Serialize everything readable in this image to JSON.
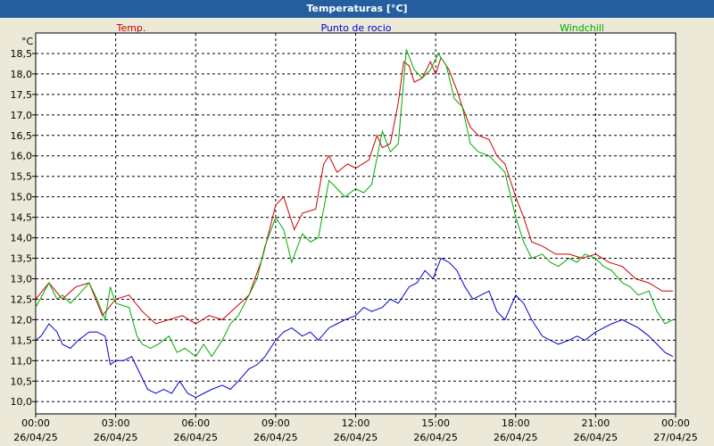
{
  "window": {
    "title": "Temperaturas [°C]"
  },
  "colors": {
    "temp": "#cc0000",
    "dew": "#0000cc",
    "wind": "#00aa00",
    "background": "#ece9d8",
    "title_bar": "#245e9e"
  },
  "chart_data": {
    "type": "line",
    "title": "Temperaturas [°C]",
    "ylabel": "°C",
    "ylim": [
      9.7,
      19.0
    ],
    "xlim": [
      0,
      24
    ],
    "grid": true,
    "legend_position": "top",
    "y_ticks": [
      "10,0",
      "10,5",
      "11,0",
      "11,5",
      "12,0",
      "12,5",
      "13,0",
      "13,5",
      "14,0",
      "14,5",
      "15,0",
      "15,5",
      "16,0",
      "16,5",
      "17,0",
      "17,5",
      "18,0",
      "18,5"
    ],
    "x_ticks": [
      {
        "time": "00:00",
        "date": "26/04/25"
      },
      {
        "time": "03:00",
        "date": "26/04/25"
      },
      {
        "time": "06:00",
        "date": "26/04/25"
      },
      {
        "time": "09:00",
        "date": "26/04/25"
      },
      {
        "time": "12:00",
        "date": "26/04/25"
      },
      {
        "time": "15:00",
        "date": "26/04/25"
      },
      {
        "time": "18:00",
        "date": "26/04/25"
      },
      {
        "time": "21:00",
        "date": "26/04/25"
      },
      {
        "time": "00:00",
        "date": "27/04/25"
      }
    ],
    "series": [
      {
        "name": "Temp.",
        "color": "#cc0000",
        "points": [
          [
            0.0,
            12.5
          ],
          [
            0.5,
            12.9
          ],
          [
            1.0,
            12.5
          ],
          [
            1.5,
            12.8
          ],
          [
            2.0,
            12.9
          ],
          [
            2.5,
            12.1
          ],
          [
            3.0,
            12.5
          ],
          [
            3.5,
            12.6
          ],
          [
            4.0,
            12.2
          ],
          [
            4.5,
            11.9
          ],
          [
            5.0,
            12.0
          ],
          [
            5.5,
            12.1
          ],
          [
            6.0,
            11.9
          ],
          [
            6.5,
            12.1
          ],
          [
            7.0,
            12.0
          ],
          [
            7.5,
            12.3
          ],
          [
            8.0,
            12.6
          ],
          [
            8.5,
            13.5
          ],
          [
            9.0,
            14.8
          ],
          [
            9.3,
            15.0
          ],
          [
            9.7,
            14.2
          ],
          [
            10.0,
            14.6
          ],
          [
            10.5,
            14.7
          ],
          [
            10.8,
            15.8
          ],
          [
            11.0,
            16.0
          ],
          [
            11.3,
            15.6
          ],
          [
            11.7,
            15.8
          ],
          [
            12.0,
            15.7
          ],
          [
            12.5,
            15.9
          ],
          [
            12.8,
            16.5
          ],
          [
            13.0,
            16.2
          ],
          [
            13.3,
            16.3
          ],
          [
            13.6,
            17.3
          ],
          [
            13.8,
            18.3
          ],
          [
            14.0,
            18.2
          ],
          [
            14.2,
            17.8
          ],
          [
            14.5,
            17.9
          ],
          [
            14.8,
            18.3
          ],
          [
            15.0,
            18.0
          ],
          [
            15.2,
            18.4
          ],
          [
            15.5,
            18.1
          ],
          [
            15.8,
            17.6
          ],
          [
            16.0,
            17.2
          ],
          [
            16.3,
            16.7
          ],
          [
            16.6,
            16.5
          ],
          [
            17.0,
            16.4
          ],
          [
            17.3,
            16.0
          ],
          [
            17.6,
            15.8
          ],
          [
            18.0,
            15.0
          ],
          [
            18.3,
            14.5
          ],
          [
            18.6,
            13.9
          ],
          [
            19.0,
            13.8
          ],
          [
            19.5,
            13.6
          ],
          [
            20.0,
            13.6
          ],
          [
            20.5,
            13.5
          ],
          [
            21.0,
            13.6
          ],
          [
            21.5,
            13.4
          ],
          [
            22.0,
            13.3
          ],
          [
            22.5,
            13.0
          ],
          [
            23.0,
            12.9
          ],
          [
            23.5,
            12.7
          ],
          [
            23.9,
            12.7
          ]
        ]
      },
      {
        "name": "Punto de rocio",
        "color": "#0000cc",
        "points": [
          [
            0.0,
            11.5
          ],
          [
            0.2,
            11.6
          ],
          [
            0.5,
            11.9
          ],
          [
            0.8,
            11.7
          ],
          [
            1.0,
            11.4
          ],
          [
            1.3,
            11.3
          ],
          [
            1.6,
            11.5
          ],
          [
            2.0,
            11.7
          ],
          [
            2.3,
            11.7
          ],
          [
            2.6,
            11.6
          ],
          [
            2.8,
            10.9
          ],
          [
            3.0,
            11.0
          ],
          [
            3.3,
            11.0
          ],
          [
            3.6,
            11.1
          ],
          [
            3.9,
            10.7
          ],
          [
            4.2,
            10.3
          ],
          [
            4.5,
            10.2
          ],
          [
            4.8,
            10.3
          ],
          [
            5.1,
            10.2
          ],
          [
            5.4,
            10.5
          ],
          [
            5.7,
            10.2
          ],
          [
            6.0,
            10.1
          ],
          [
            6.3,
            10.2
          ],
          [
            6.6,
            10.3
          ],
          [
            7.0,
            10.4
          ],
          [
            7.3,
            10.3
          ],
          [
            7.6,
            10.5
          ],
          [
            8.0,
            10.8
          ],
          [
            8.3,
            10.9
          ],
          [
            8.6,
            11.1
          ],
          [
            9.0,
            11.5
          ],
          [
            9.3,
            11.7
          ],
          [
            9.6,
            11.8
          ],
          [
            10.0,
            11.6
          ],
          [
            10.3,
            11.7
          ],
          [
            10.6,
            11.5
          ],
          [
            11.0,
            11.8
          ],
          [
            11.3,
            11.9
          ],
          [
            11.6,
            12.0
          ],
          [
            12.0,
            12.1
          ],
          [
            12.3,
            12.3
          ],
          [
            12.6,
            12.2
          ],
          [
            13.0,
            12.3
          ],
          [
            13.3,
            12.5
          ],
          [
            13.6,
            12.4
          ],
          [
            14.0,
            12.8
          ],
          [
            14.3,
            12.9
          ],
          [
            14.6,
            13.2
          ],
          [
            14.9,
            13.0
          ],
          [
            15.2,
            13.5
          ],
          [
            15.5,
            13.4
          ],
          [
            15.8,
            13.2
          ],
          [
            16.1,
            12.8
          ],
          [
            16.4,
            12.5
          ],
          [
            16.7,
            12.6
          ],
          [
            17.0,
            12.7
          ],
          [
            17.3,
            12.2
          ],
          [
            17.6,
            12.0
          ],
          [
            18.0,
            12.6
          ],
          [
            18.3,
            12.4
          ],
          [
            18.6,
            12.0
          ],
          [
            19.0,
            11.6
          ],
          [
            19.3,
            11.5
          ],
          [
            19.6,
            11.4
          ],
          [
            20.0,
            11.5
          ],
          [
            20.3,
            11.6
          ],
          [
            20.6,
            11.5
          ],
          [
            21.0,
            11.7
          ],
          [
            21.3,
            11.8
          ],
          [
            21.6,
            11.9
          ],
          [
            22.0,
            12.0
          ],
          [
            22.3,
            11.9
          ],
          [
            22.6,
            11.8
          ],
          [
            23.0,
            11.6
          ],
          [
            23.3,
            11.4
          ],
          [
            23.6,
            11.2
          ],
          [
            23.9,
            11.1
          ]
        ]
      },
      {
        "name": "Windchill",
        "color": "#00aa00",
        "points": [
          [
            0.0,
            12.3
          ],
          [
            0.5,
            12.9
          ],
          [
            0.8,
            12.5
          ],
          [
            1.0,
            12.6
          ],
          [
            1.3,
            12.4
          ],
          [
            1.6,
            12.6
          ],
          [
            2.0,
            12.9
          ],
          [
            2.3,
            12.5
          ],
          [
            2.6,
            12.0
          ],
          [
            2.8,
            12.8
          ],
          [
            3.0,
            12.4
          ],
          [
            3.5,
            12.3
          ],
          [
            3.8,
            11.6
          ],
          [
            4.0,
            11.4
          ],
          [
            4.3,
            11.3
          ],
          [
            4.6,
            11.4
          ],
          [
            5.0,
            11.6
          ],
          [
            5.3,
            11.2
          ],
          [
            5.6,
            11.3
          ],
          [
            6.0,
            11.1
          ],
          [
            6.3,
            11.4
          ],
          [
            6.6,
            11.1
          ],
          [
            7.0,
            11.5
          ],
          [
            7.3,
            11.9
          ],
          [
            7.6,
            12.1
          ],
          [
            8.0,
            12.6
          ],
          [
            8.3,
            13.0
          ],
          [
            8.6,
            13.8
          ],
          [
            9.0,
            14.5
          ],
          [
            9.3,
            14.2
          ],
          [
            9.6,
            13.4
          ],
          [
            10.0,
            14.1
          ],
          [
            10.3,
            13.9
          ],
          [
            10.6,
            14.0
          ],
          [
            11.0,
            15.4
          ],
          [
            11.3,
            15.2
          ],
          [
            11.6,
            15.0
          ],
          [
            12.0,
            15.2
          ],
          [
            12.3,
            15.1
          ],
          [
            12.6,
            15.3
          ],
          [
            13.0,
            16.6
          ],
          [
            13.3,
            16.1
          ],
          [
            13.6,
            16.3
          ],
          [
            13.9,
            18.6
          ],
          [
            14.2,
            18.1
          ],
          [
            14.5,
            17.9
          ],
          [
            14.8,
            18.1
          ],
          [
            15.1,
            18.5
          ],
          [
            15.4,
            18.2
          ],
          [
            15.7,
            17.4
          ],
          [
            16.0,
            17.2
          ],
          [
            16.3,
            16.3
          ],
          [
            16.6,
            16.1
          ],
          [
            17.0,
            16.0
          ],
          [
            17.3,
            15.8
          ],
          [
            17.6,
            15.6
          ],
          [
            18.0,
            14.5
          ],
          [
            18.3,
            13.9
          ],
          [
            18.6,
            13.5
          ],
          [
            19.0,
            13.6
          ],
          [
            19.3,
            13.4
          ],
          [
            19.6,
            13.3
          ],
          [
            20.0,
            13.5
          ],
          [
            20.3,
            13.4
          ],
          [
            20.6,
            13.6
          ],
          [
            21.0,
            13.5
          ],
          [
            21.3,
            13.3
          ],
          [
            21.6,
            13.2
          ],
          [
            22.0,
            12.9
          ],
          [
            22.3,
            12.8
          ],
          [
            22.6,
            12.6
          ],
          [
            23.0,
            12.7
          ],
          [
            23.3,
            12.2
          ],
          [
            23.6,
            11.9
          ],
          [
            23.9,
            12.0
          ]
        ]
      }
    ]
  }
}
